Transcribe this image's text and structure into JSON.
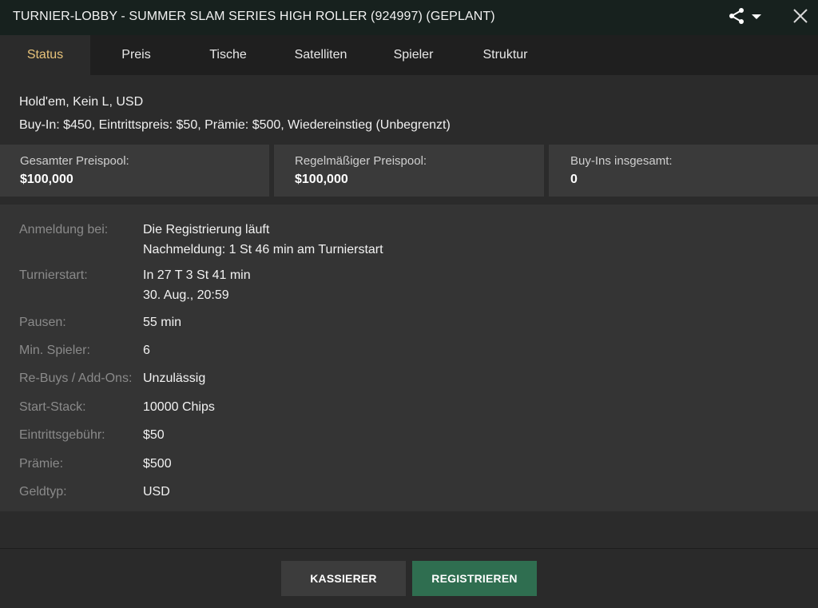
{
  "window": {
    "title": "TURNIER-LOBBY - SUMMER SLAM SERIES HIGH ROLLER (924997) (GEPLANT)"
  },
  "icons": {
    "share": "share-icon",
    "dropdown": "caret-down-icon",
    "close": "close-icon"
  },
  "tabs": [
    {
      "label": "Status",
      "active": true
    },
    {
      "label": "Preis",
      "active": false
    },
    {
      "label": "Tische",
      "active": false
    },
    {
      "label": "Satelliten",
      "active": false
    },
    {
      "label": "Spieler",
      "active": false
    },
    {
      "label": "Struktur",
      "active": false
    }
  ],
  "info": {
    "game": "Hold'em, Kein L, USD",
    "fees": "Buy-In: $450, Eintrittspreis: $50, Prämie: $500, Wiedereinstieg (Unbegrenzt)"
  },
  "stats": [
    {
      "label": "Gesamter Preispool:",
      "value": "$100,000"
    },
    {
      "label": "Regelmäßiger Preispool:",
      "value": "$100,000"
    },
    {
      "label": "Buy-Ins insgesamt:",
      "value": "0"
    }
  ],
  "details": [
    {
      "label": "Anmeldung bei:",
      "value": "Die Registrierung läuft",
      "value2": "Nachmeldung: 1 St 46 min am Turnierstart"
    },
    {
      "label": "Turnierstart:",
      "value": "In 27 T 3 St 41 min",
      "value2": "30. Aug., 20:59"
    },
    {
      "label": "Pausen:",
      "value": "55 min"
    },
    {
      "label": "Min. Spieler:",
      "value": "6"
    },
    {
      "label": "Re-Buys / Add-Ons:",
      "value": "Unzulässig"
    },
    {
      "label": "Start-Stack:",
      "value": "10000 Chips"
    },
    {
      "label": "Eintrittsgebühr:",
      "value": "$50"
    },
    {
      "label": "Prämie:",
      "value": "$500"
    },
    {
      "label": "Geldtyp:",
      "value": "USD"
    }
  ],
  "footer": {
    "cashier_label": "KASSIERER",
    "register_label": "REGISTRIEREN"
  },
  "colors": {
    "accent_tab": "#e8c37a",
    "register_button": "#2f6e50",
    "titlebar": "#17211e"
  }
}
